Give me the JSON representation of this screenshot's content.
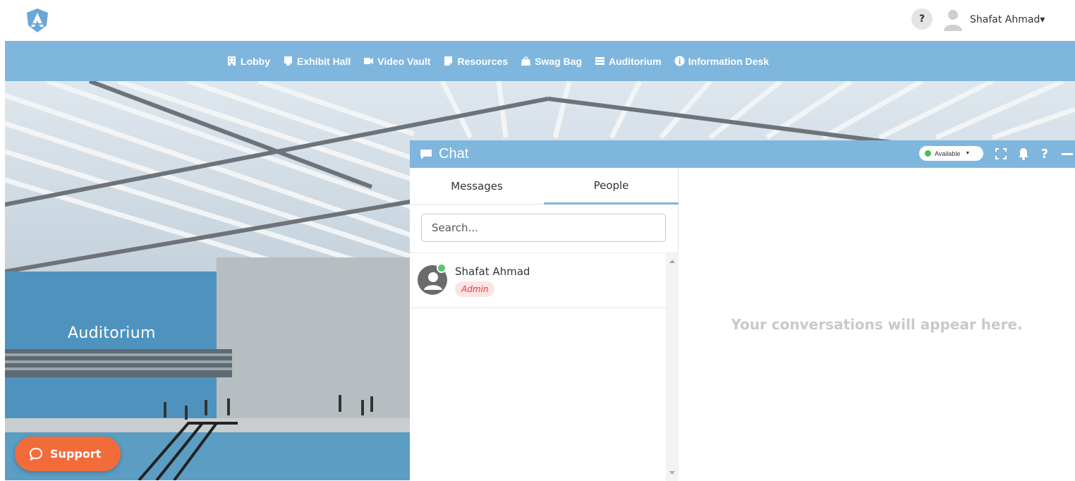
{
  "header": {
    "logo_icon": "shield-logo-icon",
    "help_label": "?",
    "user_name": "Shafat Ahmad▾"
  },
  "nav": {
    "items": [
      {
        "label": "Lobby",
        "icon": "building-icon"
      },
      {
        "label": "Exhibit Hall",
        "icon": "booth-icon"
      },
      {
        "label": "Video Vault",
        "icon": "video-camera-icon"
      },
      {
        "label": "Resources",
        "icon": "document-icon"
      },
      {
        "label": "Swag Bag",
        "icon": "bag-icon"
      },
      {
        "label": "Auditorium",
        "icon": "list-icon"
      },
      {
        "label": "Information Desk",
        "icon": "info-icon"
      }
    ]
  },
  "scene": {
    "label": "Auditorium"
  },
  "support": {
    "label": "Support",
    "icon": "chat-bubble-icon"
  },
  "chat": {
    "title": "Chat",
    "status": "Available",
    "tabs": [
      "Messages",
      "People"
    ],
    "active_tab": "People",
    "search_placeholder": "Search...",
    "people": [
      {
        "name": "Shafat Ahmad",
        "role": "Admin",
        "online": true
      }
    ],
    "empty_message": "Your conversations will appear here."
  },
  "colors": {
    "accent": "#7fb6de",
    "support": "#f26c3b",
    "online": "#5fc36b",
    "admin_badge_bg": "#fde4e4",
    "admin_badge_text": "#e03a3a"
  }
}
